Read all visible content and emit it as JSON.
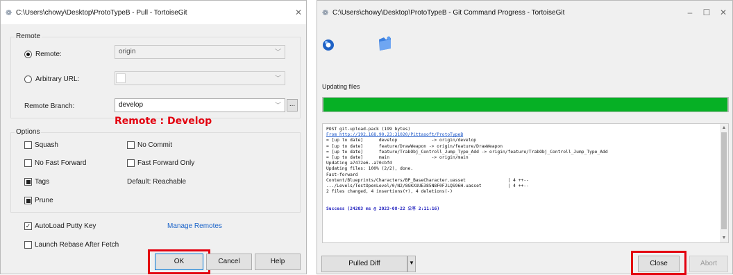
{
  "pull_window": {
    "title": "C:\\Users\\chowy\\Desktop\\ProtoTypeB - Pull - TortoiseGit",
    "remote_group": "Remote",
    "remote_radio": "Remote:",
    "remote_value": "origin",
    "arbitrary_url_radio": "Arbitrary URL:",
    "remote_branch_label": "Remote Branch:",
    "remote_branch_value": "develop",
    "browse_button": "...",
    "annotation": "Remote : Develop",
    "options_group": "Options",
    "squash": "Squash",
    "no_commit": "No Commit",
    "no_fast_forward": "No Fast Forward",
    "fast_forward_only": "Fast Forward Only",
    "tags": "Tags",
    "default_reachable": "Default: Reachable",
    "prune": "Prune",
    "autoload_putty_key": "AutoLoad Putty Key",
    "manage_remotes": "Manage Remotes",
    "launch_rebase": "Launch Rebase After Fetch",
    "ok": "OK",
    "cancel": "Cancel",
    "help": "Help",
    "close_glyph": "✕"
  },
  "progress_window": {
    "title": "C:\\Users\\chowy\\Desktop\\ProtoTypeB - Git Command Progress - TortoiseGit",
    "minimize_glyph": "–",
    "maximize_glyph": "☐",
    "close_glyph": "✕",
    "status": "Updating files",
    "progress_fraction": 1.0,
    "progress_color": "#06b025",
    "log": [
      {
        "text": "POST git-upload-pack (199 bytes)",
        "kind": "normal"
      },
      {
        "text": "From http://192.168.90.23:31020/Pittasoft/ProtoTypeB",
        "kind": "url"
      },
      {
        "text": "= [up to date]      develop             -> origin/develop",
        "kind": "normal"
      },
      {
        "text": "= [up to date]      feature/DrawWeapon -> origin/feature/DrawWeapon",
        "kind": "normal"
      },
      {
        "text": "= [up to date]      feature/TrabObj_Controll_Jump_Type_Add -> origin/feature/TrabObj_Controll_Jump_Type_Add",
        "kind": "normal"
      },
      {
        "text": "= [up to date]      main                -> origin/main",
        "kind": "normal"
      },
      {
        "text": "Updating a7472e6..a70cbfd",
        "kind": "normal"
      },
      {
        "text": "Updating files: 100% (2/2), done.",
        "kind": "normal"
      },
      {
        "text": "Fast-forward",
        "kind": "normal"
      },
      {
        "text": "Content/Blueprints/Characters/BP_BaseCharacter.uasset                | 4 ++--",
        "kind": "normal"
      },
      {
        "text": ".../Levels/TestOpenLevel/0/N2/8GKXUUE385N8F0FJLQS96H.uasset          | 4 ++--",
        "kind": "normal"
      },
      {
        "text": "2 files changed, 4 insertions(+), 4 deletions(-)",
        "kind": "normal"
      },
      {
        "text": "",
        "kind": "normal"
      },
      {
        "text": "",
        "kind": "normal"
      },
      {
        "text": "Success (24203 ms @ 2023-08-22 오후 2:11:16)",
        "kind": "success"
      }
    ],
    "pulled_diff": "Pulled Diff",
    "close": "Close",
    "abort": "Abort"
  },
  "colors": {
    "highlight": "#e3000f",
    "link": "#1a63c9",
    "success_text": "#1d1dbd"
  },
  "icons": [
    "tortoisegit-icon",
    "status-circle-icon",
    "folder-icon",
    "dropdown-arrow-icon"
  ]
}
